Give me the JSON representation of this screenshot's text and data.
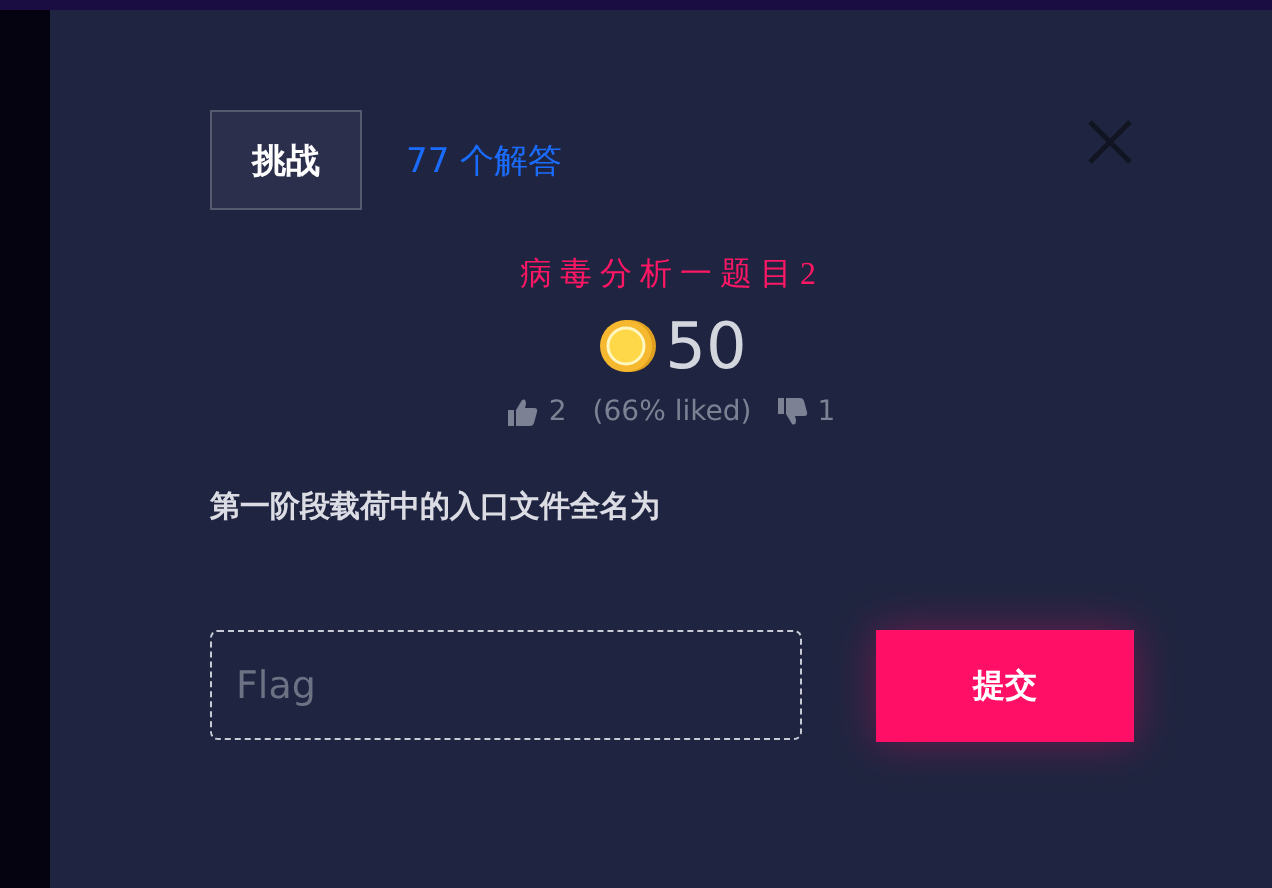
{
  "tabs": [
    {
      "label": "挑战",
      "selected": true
    },
    {
      "label": "77 个解答",
      "selected": false
    }
  ],
  "challenge": {
    "title": "病毒分析一题目2",
    "points": "50",
    "likes": "2",
    "liked_share": "(66% liked)",
    "dislikes": "1",
    "description": "第一阶段载荷中的入口文件全名为"
  },
  "flag_field": {
    "placeholder": "Flag"
  },
  "submit_button": "提交"
}
